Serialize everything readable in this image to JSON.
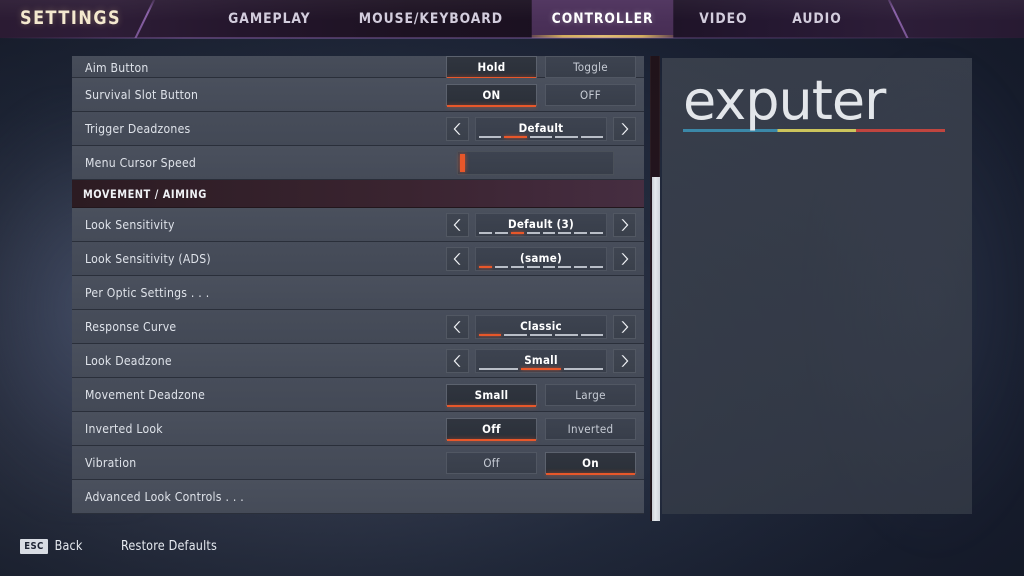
{
  "header": {
    "title": "SETTINGS",
    "tabs": [
      {
        "label": "GAMEPLAY",
        "active": false
      },
      {
        "label": "MOUSE/KEYBOARD",
        "active": false
      },
      {
        "label": "CONTROLLER",
        "active": true
      },
      {
        "label": "VIDEO",
        "active": false
      },
      {
        "label": "AUDIO",
        "active": false
      }
    ]
  },
  "colors": {
    "accent_orange": "#e8572a",
    "active_tab_bg": "#4b3159",
    "active_tab_underline": "#d3ad5c",
    "title_cream": "#f4e9cf",
    "row_bg": "#474d5a",
    "section_header_bg": "#3a2430"
  },
  "rows": [
    {
      "label": "Aim Button",
      "control": "toggle",
      "clipped": true,
      "options": [
        {
          "label": "Hold",
          "selected": true
        },
        {
          "label": "Toggle",
          "selected": false
        }
      ]
    },
    {
      "label": "Survival Slot Button",
      "control": "toggle",
      "options": [
        {
          "label": "ON",
          "selected": true
        },
        {
          "label": "OFF",
          "selected": false
        }
      ]
    },
    {
      "label": "Trigger Deadzones",
      "control": "stepper",
      "value": "Default",
      "segments": 5,
      "active_segment": 2,
      "prev_icon": "chevron-left-icon",
      "next_icon": "chevron-right-icon"
    },
    {
      "label": "Menu Cursor Speed",
      "control": "slider",
      "handle_percent": 0
    },
    {
      "label": "MOVEMENT / AIMING",
      "control": "section"
    },
    {
      "label": "Look Sensitivity",
      "control": "stepper",
      "value": "Default (3)",
      "segments": 8,
      "active_segment": 3,
      "prev_icon": "chevron-left-icon",
      "next_icon": "chevron-right-icon"
    },
    {
      "label": "Look Sensitivity  (ADS)",
      "control": "stepper",
      "value": "(same)",
      "segments": 8,
      "active_segment": 1,
      "prev_icon": "chevron-left-icon",
      "next_icon": "chevron-right-icon"
    },
    {
      "label": "Per Optic Settings . . .",
      "control": "none"
    },
    {
      "label": "Response Curve",
      "control": "stepper",
      "value": "Classic",
      "segments": 5,
      "active_segment": 1,
      "prev_icon": "chevron-left-icon",
      "next_icon": "chevron-right-icon"
    },
    {
      "label": "Look Deadzone",
      "control": "stepper",
      "value": "Small",
      "segments": 3,
      "active_segment": 2,
      "prev_icon": "chevron-left-icon",
      "next_icon": "chevron-right-icon"
    },
    {
      "label": "Movement Deadzone",
      "control": "toggle",
      "options": [
        {
          "label": "Small",
          "selected": true
        },
        {
          "label": "Large",
          "selected": false
        }
      ]
    },
    {
      "label": "Inverted Look",
      "control": "toggle",
      "options": [
        {
          "label": "Off",
          "selected": true
        },
        {
          "label": "Inverted",
          "selected": false
        }
      ]
    },
    {
      "label": "Vibration",
      "control": "toggle",
      "options": [
        {
          "label": "Off",
          "selected": false
        },
        {
          "label": "On",
          "selected": true
        }
      ]
    },
    {
      "label": "Advanced Look Controls . . .",
      "control": "none"
    }
  ],
  "watermark": {
    "text": "exputer",
    "underline_colors": [
      "#3b88a8",
      "#ccc45c",
      "#c0453f"
    ]
  },
  "footer": {
    "esc_key": "ESC",
    "back_label": "Back",
    "restore_label": "Restore Defaults"
  }
}
